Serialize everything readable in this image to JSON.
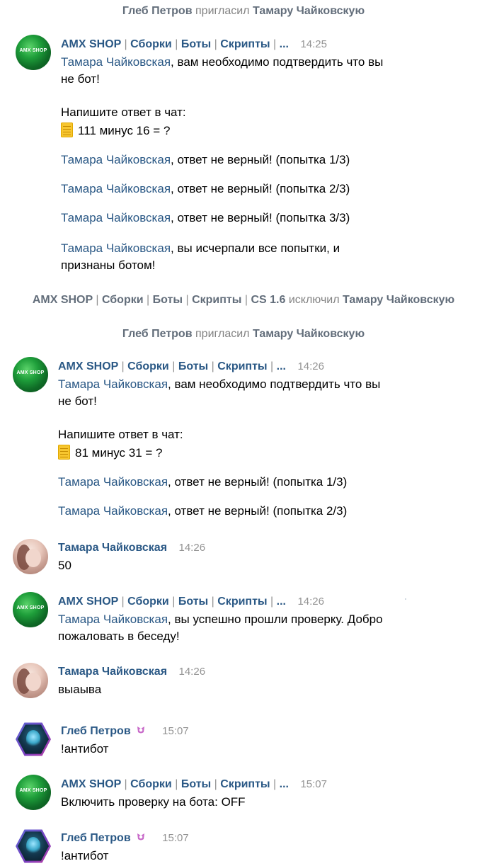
{
  "system": [
    {
      "actor": "Глеб Петров",
      "verb": "пригласил",
      "target": "Тамару Чайковскую"
    },
    {
      "actor": "AMX SHOP",
      "actor_parts": [
        "Сборки",
        "Боты",
        "Скрипты",
        "CS 1.6"
      ],
      "verb": "исключил",
      "target": "Тамару Чайковскую"
    },
    {
      "actor": "Глеб Петров",
      "verb": "пригласил",
      "target": "Тамару Чайковскую"
    }
  ],
  "bot": {
    "name": "AMX SHOP",
    "name_parts": [
      "Сборки",
      "Боты",
      "Скрипты",
      "..."
    ],
    "avatar_text": "AMX SHOP"
  },
  "pipe": "|",
  "messages": [
    {
      "time": "14:25",
      "lines": [
        {
          "mention": "Тамара Чайковская",
          "text": ", вам необходимо подтвердить что вы"
        },
        {
          "text": "не бот!"
        },
        {
          "text": "Напишите ответ в чат:"
        },
        {
          "icon": "notepad-icon",
          "text": "111 минус 16 = ?"
        },
        {
          "mention": "Тамара Чайковская",
          "text": ", ответ не верный! (попытка 1/3)"
        },
        {
          "mention": "Тамара Чайковская",
          "text": ", ответ не верный! (попытка 2/3)"
        },
        {
          "mention": "Тамара Чайковская",
          "text": ", ответ не верный! (попытка 3/3)"
        },
        {
          "mention": "Тамара Чайковская",
          "text": ", вы исчерпали все попытки, и"
        },
        {
          "text": "признаны ботом!"
        }
      ]
    },
    {
      "time": "14:26",
      "lines": [
        {
          "mention": "Тамара Чайковская",
          "text": ", вам необходимо подтвердить что вы"
        },
        {
          "text": "не бот!"
        },
        {
          "text": "Напишите ответ в чат:"
        },
        {
          "icon": "notepad-icon",
          "text": "81 минус 31 = ?"
        },
        {
          "mention": "Тамара Чайковская",
          "text": ", ответ не верный! (попытка 1/3)"
        },
        {
          "mention": "Тамара Чайковская",
          "text": ", ответ не верный! (попытка 2/3)"
        }
      ]
    },
    {
      "sender": "Тамара Чайковская",
      "time": "14:26",
      "text": "50"
    },
    {
      "time": "14:26",
      "lines": [
        {
          "mention": "Тамара Чайковская",
          "text": ", вы успешно прошли проверку. Добро"
        },
        {
          "text": "пожаловать в беседу!"
        }
      ]
    },
    {
      "sender": "Тамара Чайковская",
      "time": "14:26",
      "text": "выаыва"
    },
    {
      "sender": "Глеб Петров",
      "time": "15:07",
      "text": "!антибот",
      "badge": "admin-badge-icon"
    },
    {
      "time": "15:07",
      "text": "Включить проверку на бота: OFF"
    },
    {
      "sender": "Глеб Петров",
      "time": "15:07",
      "text": "!антибот",
      "badge": "admin-badge-icon"
    }
  ]
}
